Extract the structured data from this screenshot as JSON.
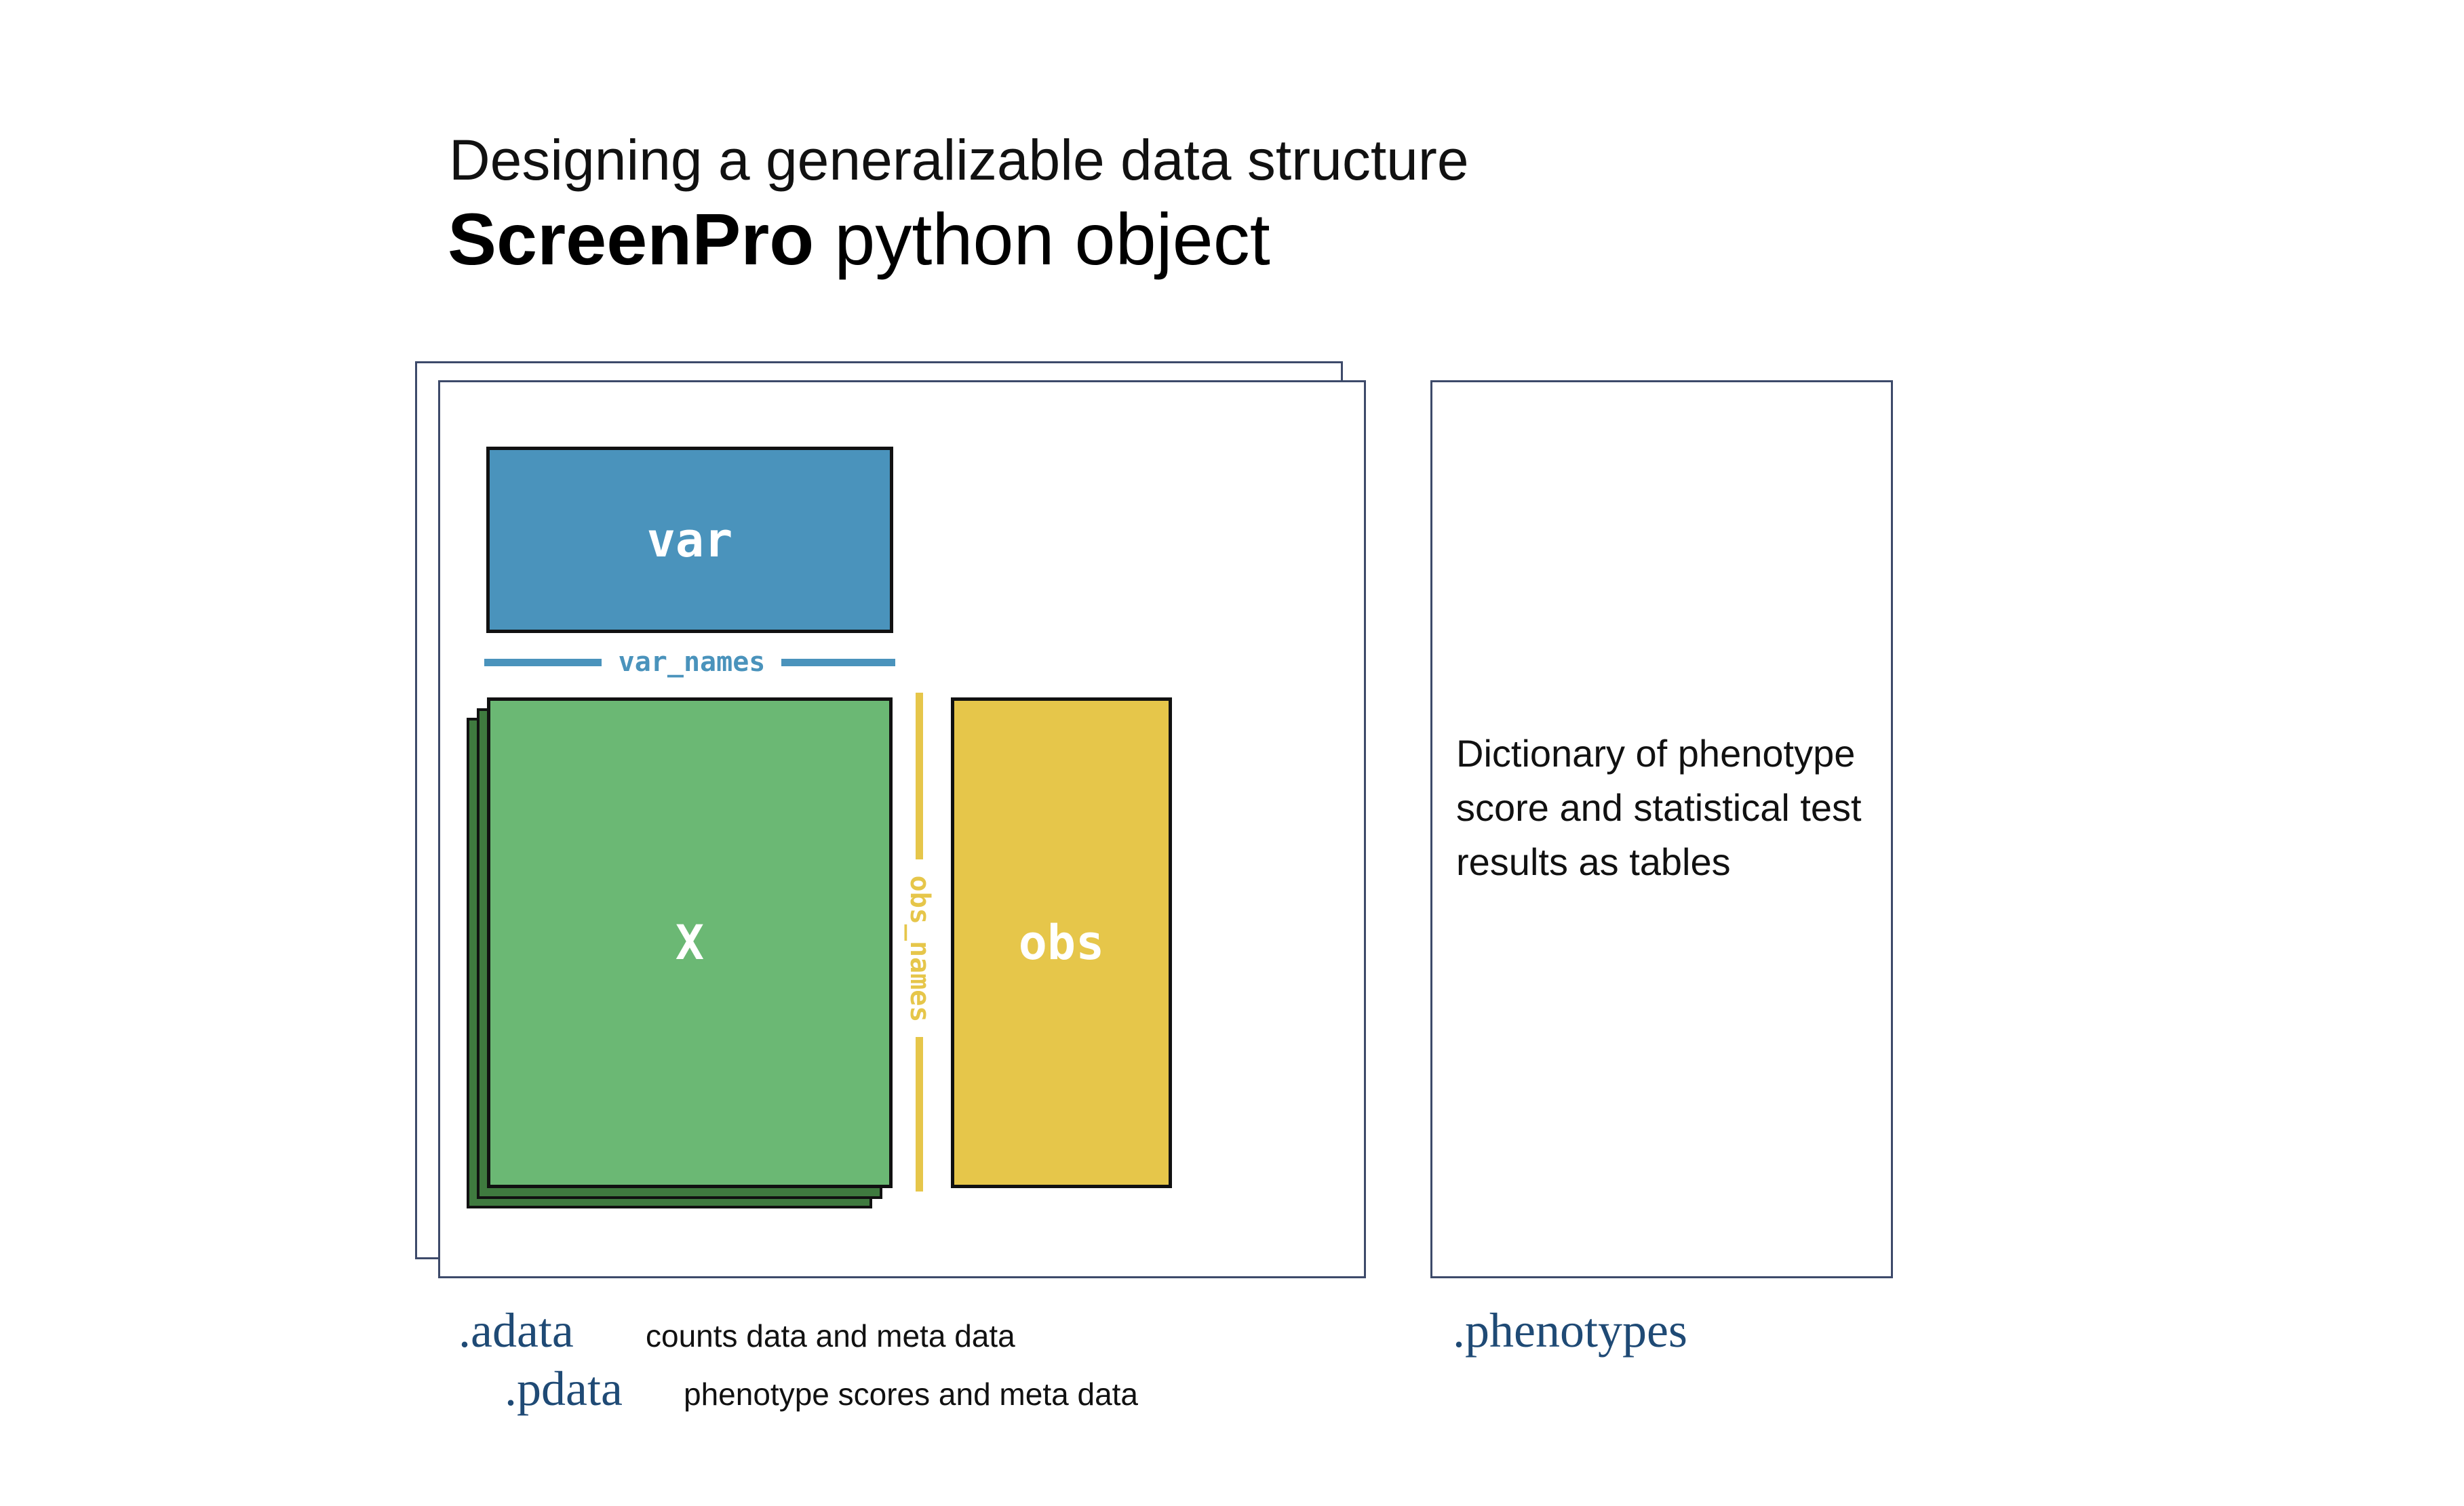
{
  "title": {
    "line1": "Designing a generalizable data structure",
    "line2_bold": "ScreenPro",
    "line2_rest": " python object"
  },
  "blocks": {
    "var": "var",
    "x": "X",
    "obs": "obs",
    "var_names": "var_names",
    "obs_names": "obs_names"
  },
  "phenotypes_box": {
    "description": "Dictionary of phenotype score and statistical test results as tables"
  },
  "attributes": {
    "adata": ".adata",
    "adata_desc": "counts data and meta data",
    "pdata": ".pdata",
    "pdata_desc": "phenotype scores and meta data",
    "phenotypes": ".phenotypes"
  },
  "colors": {
    "var": "#4a93bc",
    "x": "#6bb874",
    "x_stack": "#3f7a3f",
    "obs": "#e6c64a",
    "frame": "#3d4a6a",
    "attribute_text": "#1f4a75"
  }
}
